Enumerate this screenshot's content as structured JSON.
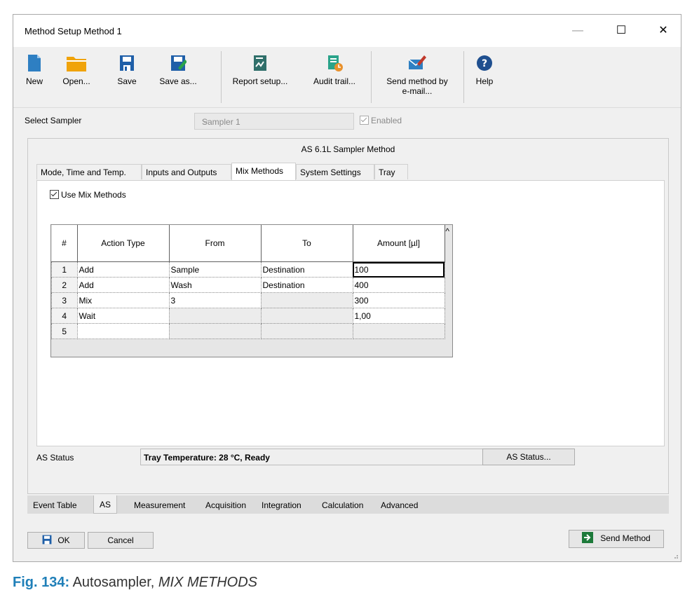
{
  "window": {
    "title": "Method Setup Method 1",
    "minimize": "—",
    "maximize": "☐",
    "close": "✕"
  },
  "toolbar": {
    "new": "New",
    "open": "Open...",
    "save": "Save",
    "save_as": "Save as...",
    "report_setup": "Report setup...",
    "audit_trail": "Audit trail...",
    "send_method_line1": "Send method by",
    "send_method_line2": "e-mail...",
    "help": "Help"
  },
  "sampler": {
    "label": "Select Sampler",
    "value": "Sampler 1",
    "enabled_label": "Enabled"
  },
  "panel": {
    "title": "AS 6.1L Sampler Method"
  },
  "tabs": [
    "Mode, Time and Temp.",
    "Inputs and Outputs",
    "Mix Methods",
    "System Settings",
    "Tray"
  ],
  "mix": {
    "use_label": "Use Mix Methods",
    "columns": [
      "#",
      "Action Type",
      "From",
      "To",
      "Amount [µl]"
    ],
    "rows": [
      [
        "1",
        "Add",
        "Sample",
        "Destination",
        "100"
      ],
      [
        "2",
        "Add",
        "Wash",
        "Destination",
        "400"
      ],
      [
        "3",
        "Mix",
        "3",
        "",
        "300"
      ],
      [
        "4",
        "Wait",
        "",
        "",
        "1,00"
      ],
      [
        "5",
        "",
        "",
        "",
        ""
      ]
    ]
  },
  "status": {
    "label": "AS Status",
    "text": "Tray Temperature: 28 °C, Ready",
    "button": "AS Status..."
  },
  "bottom_tabs": [
    "Event Table",
    "AS",
    "Measurement",
    "Acquisition",
    "Integration",
    "Calculation",
    "Advanced"
  ],
  "buttons": {
    "ok": "OK",
    "cancel": "Cancel",
    "send_method": "Send Method"
  },
  "caption": {
    "fig": "Fig. 134:",
    "text": "Autosampler,",
    "italic": "MIX METHODS"
  }
}
